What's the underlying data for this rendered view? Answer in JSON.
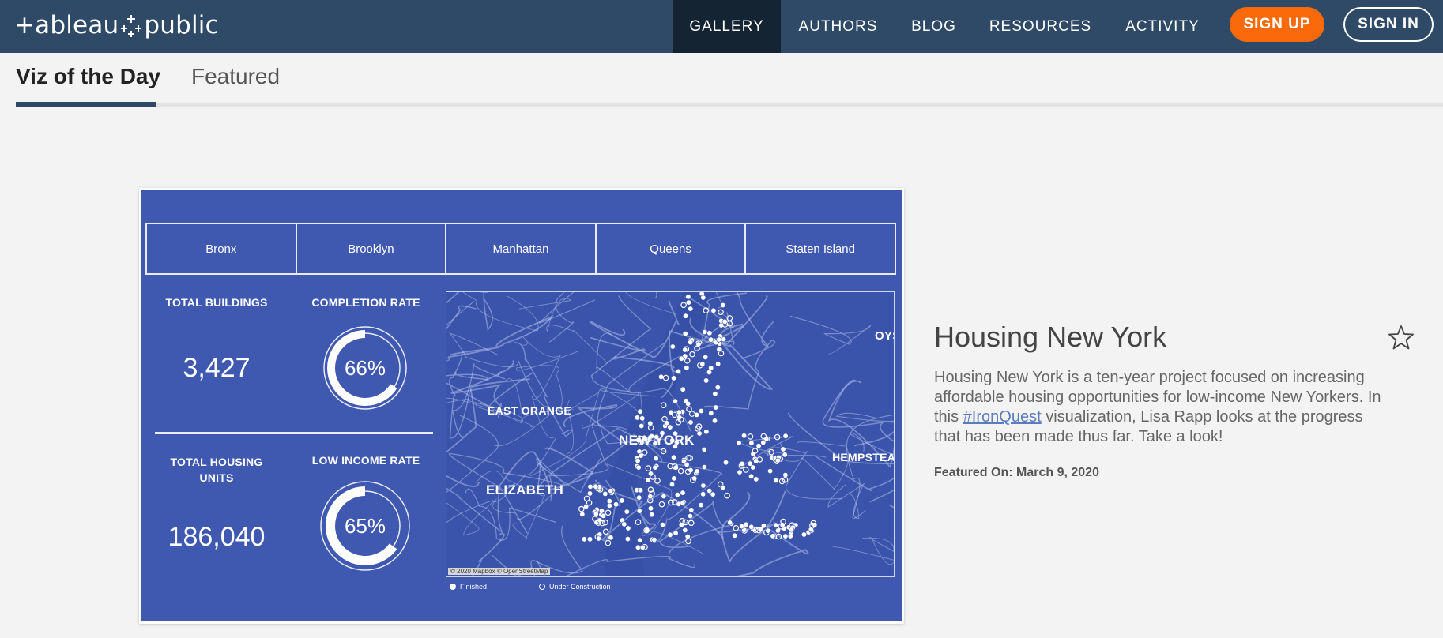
{
  "brand": {
    "logo_text_left": "+ableau",
    "logo_text_right": "public"
  },
  "nav": {
    "items": [
      {
        "label": "GALLERY",
        "active": true
      },
      {
        "label": "AUTHORS",
        "active": false
      },
      {
        "label": "BLOG",
        "active": false
      },
      {
        "label": "RESOURCES",
        "active": false
      },
      {
        "label": "ACTIVITY",
        "active": false
      }
    ],
    "signup_label": "SIGN UP",
    "signin_label": "SIGN IN"
  },
  "tabs": [
    {
      "label": "Viz of the Day",
      "active": true
    },
    {
      "label": "Featured",
      "active": false
    }
  ],
  "viz": {
    "boroughs": [
      "Bronx",
      "Brooklyn",
      "Manhattan",
      "Queens",
      "Staten Island"
    ],
    "kpis": {
      "total_buildings_label": "TOTAL BUILDINGS",
      "total_buildings_value": "3,427",
      "completion_rate_label": "COMPLETION RATE",
      "completion_rate_value": "66%",
      "completion_rate_fraction": 0.66,
      "total_units_label": "TOTAL HOUSING UNITS",
      "total_units_value": "186,040",
      "low_income_label": "LOW INCOME RATE",
      "low_income_value": "65%",
      "low_income_fraction": 0.65
    },
    "map_labels": {
      "east_orange": "EAST ORANGE",
      "elizabeth": "ELIZABETH",
      "new_york": "NEW YORK",
      "hempstead": "HEMPSTEA",
      "oyster": "OYS"
    },
    "map_credit": "© 2020 Mapbox © OpenStreetMap",
    "legend": {
      "finished": "Finished",
      "under_construction": "Under Construction"
    }
  },
  "detail": {
    "title": "Housing New York",
    "desc_before": "Housing New York is a ten-year project focused on increasing affordable housing opportunities for low-income New Yorkers. In this ",
    "desc_link": "#IronQuest",
    "desc_after": " visualization, Lisa Rapp looks at the progress that has been made thus far. Take a look!",
    "featured_on": "Featured On: March 9, 2020"
  },
  "colors": {
    "nav_bg": "#2e4a66",
    "signup": "#fa6a0a",
    "viz_bg": "#3f58b0"
  }
}
